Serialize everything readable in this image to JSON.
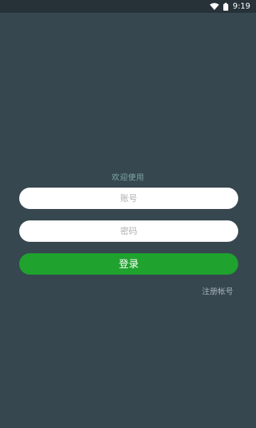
{
  "status_bar": {
    "time": "9:19",
    "icons": [
      "wifi-icon",
      "battery-icon"
    ]
  },
  "login": {
    "title": "欢迎使用",
    "account_placeholder": "账号",
    "password_placeholder": "密码",
    "login_label": "登录",
    "register_label": "注册帐号"
  },
  "colors": {
    "background": "#37474f",
    "status_bar": "#263238",
    "accent_green": "#1fa22e",
    "title_color": "#7ea6a8"
  }
}
